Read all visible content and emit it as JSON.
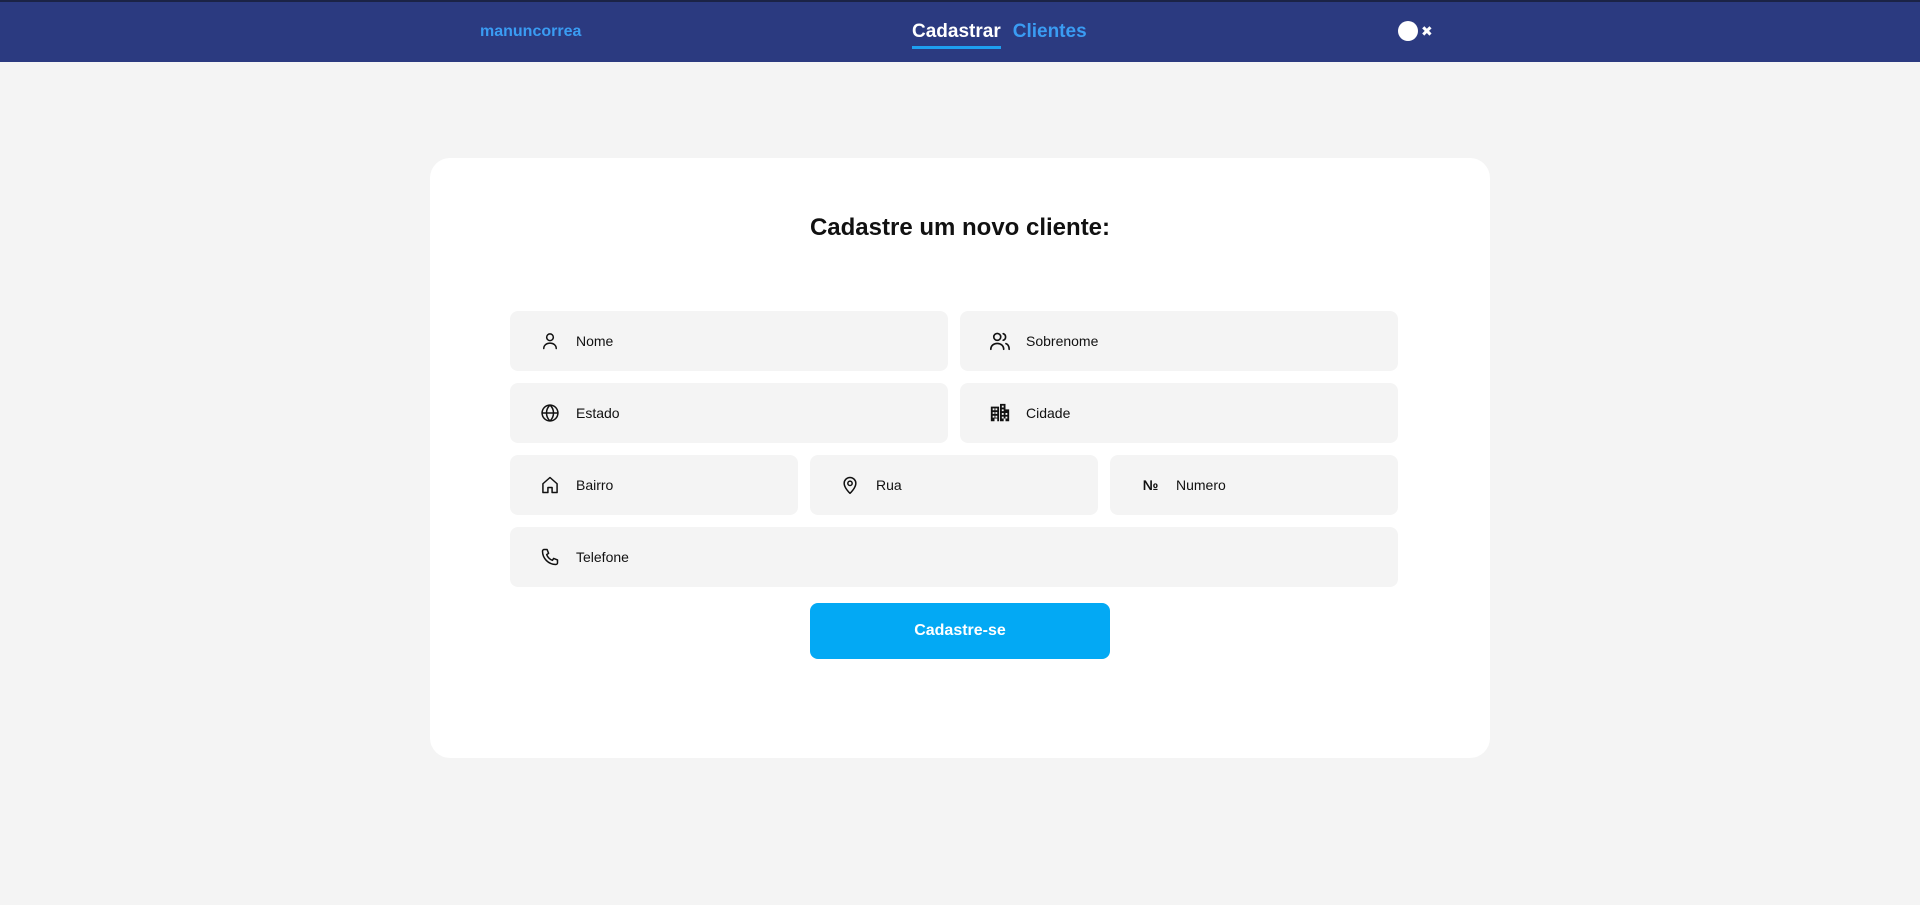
{
  "header": {
    "brand": "manuncorrea",
    "nav": [
      {
        "label": "Cadastrar",
        "active": true
      },
      {
        "label": "Clientes",
        "active": false
      }
    ],
    "theme_toggle_glyph": "✖",
    "colors": {
      "bar": "#2b3a80",
      "accent": "#3a9cf3"
    }
  },
  "form": {
    "title": "Cadastre um novo cliente:",
    "fields": {
      "nome": {
        "placeholder": "Nome",
        "icon": "user-icon"
      },
      "sobrenome": {
        "placeholder": "Sobrenome",
        "icon": "users-icon"
      },
      "estado": {
        "placeholder": "Estado",
        "icon": "globe-icon"
      },
      "cidade": {
        "placeholder": "Cidade",
        "icon": "buildings-icon"
      },
      "bairro": {
        "placeholder": "Bairro",
        "icon": "home-icon"
      },
      "rua": {
        "placeholder": "Rua",
        "icon": "map-pin-icon"
      },
      "numero": {
        "placeholder": "Numero",
        "icon": "numero-sign-icon",
        "glyph": "№"
      },
      "telefone": {
        "placeholder": "Telefone",
        "icon": "phone-icon"
      }
    },
    "submit_label": "Cadastre-se",
    "submit_color": "#03a9f4"
  }
}
